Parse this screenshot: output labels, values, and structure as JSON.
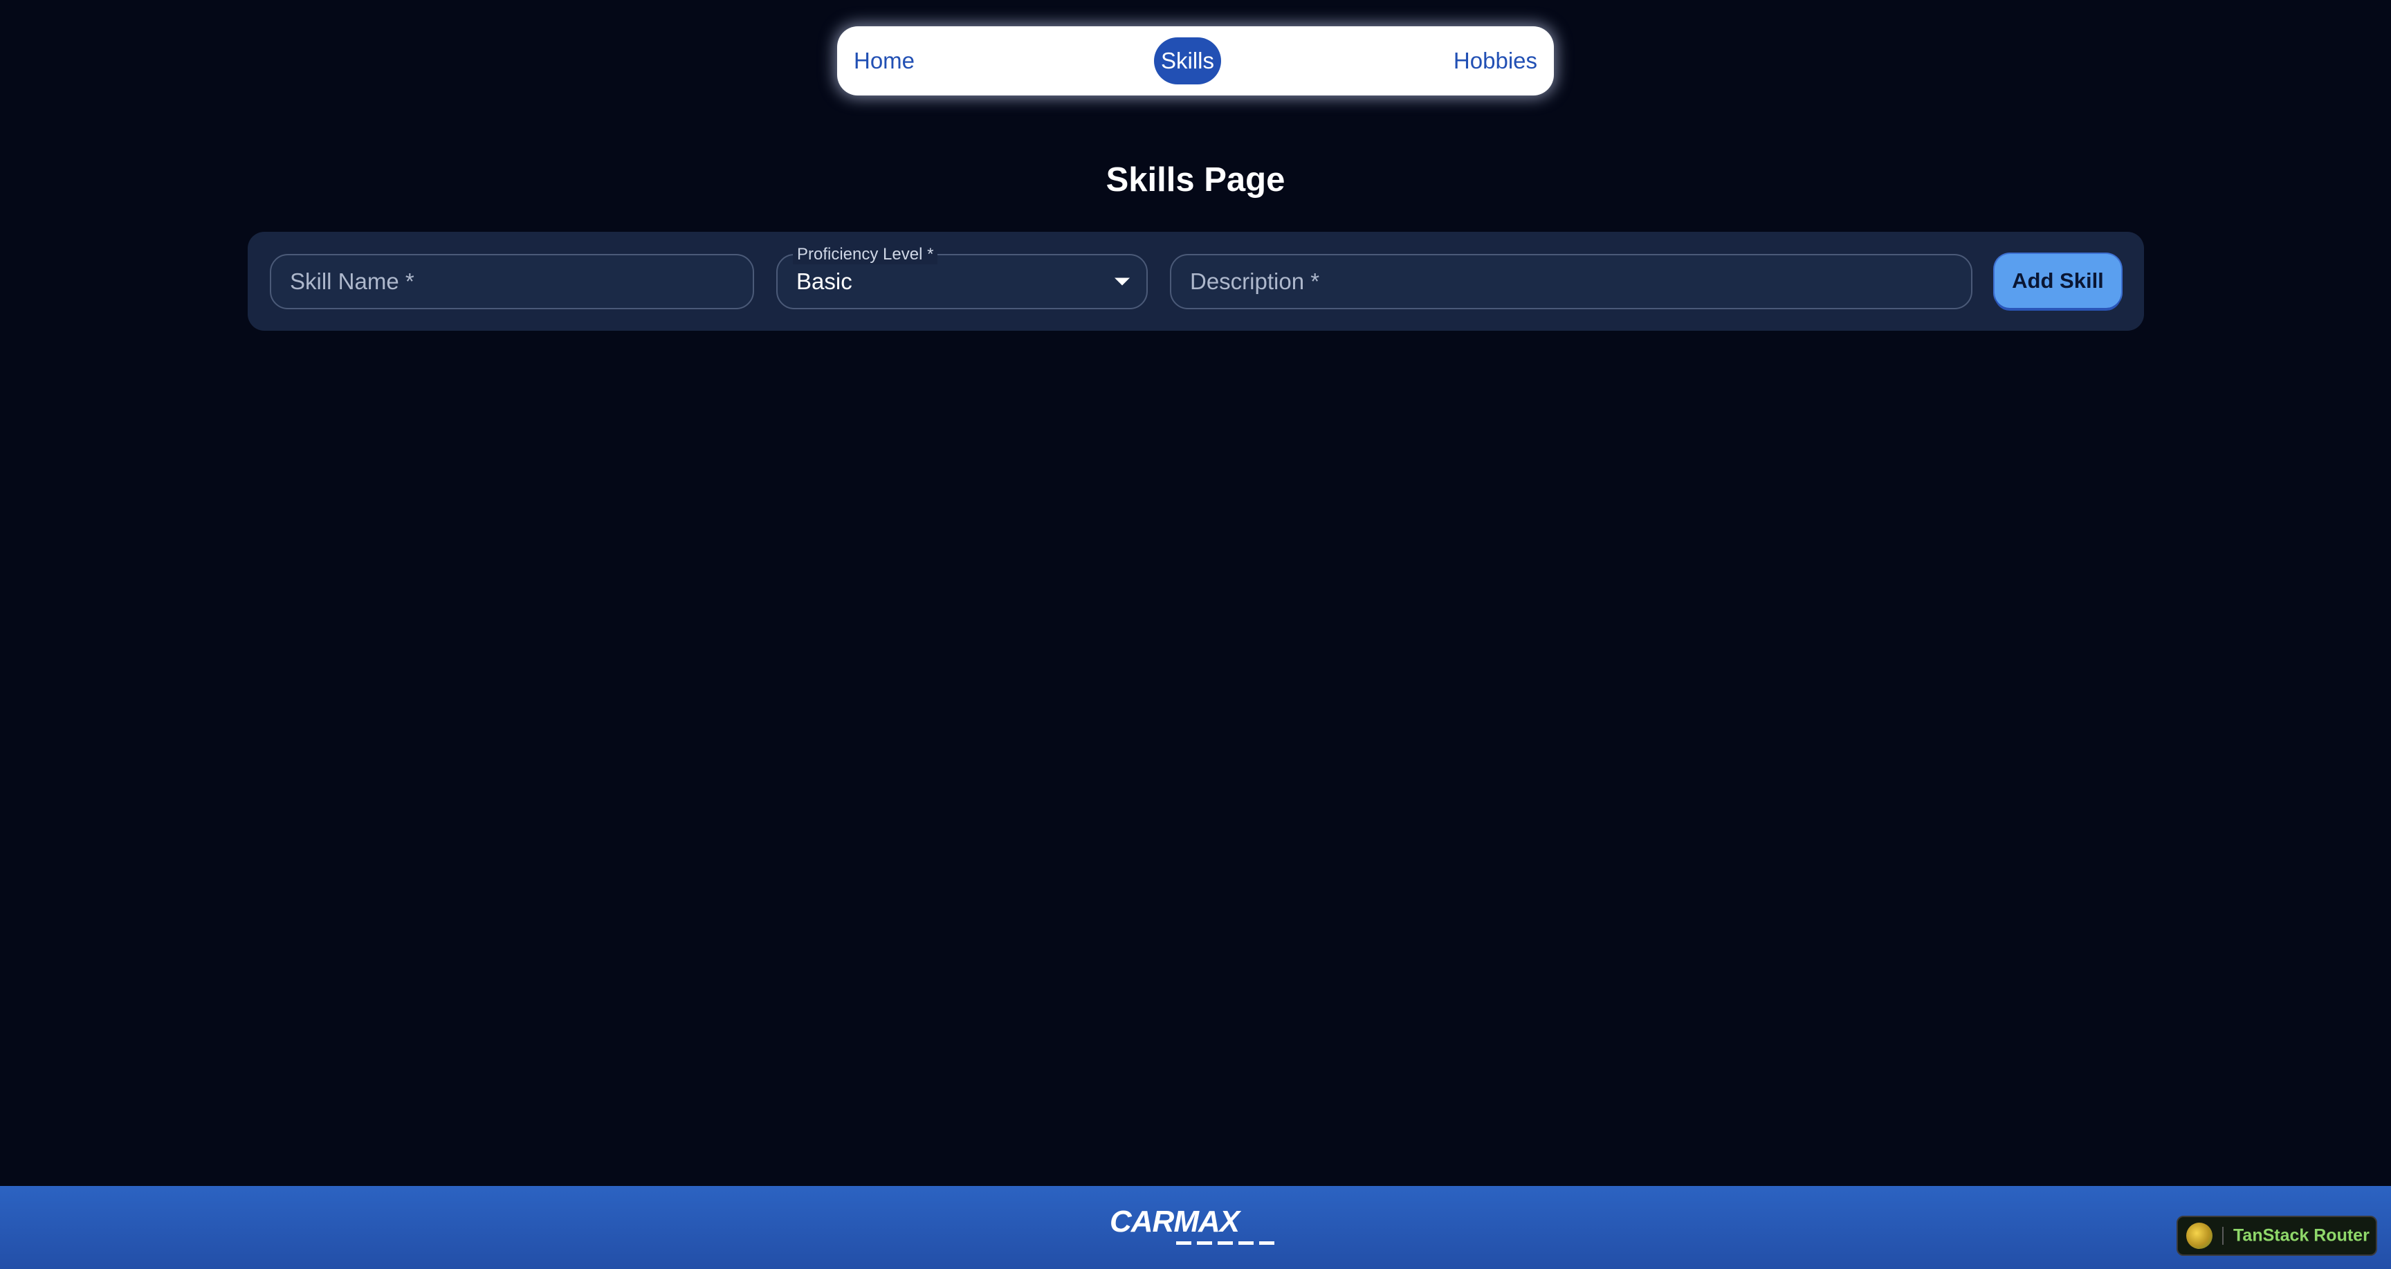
{
  "nav": {
    "home_label": "Home",
    "skills_label": "Skills",
    "hobbies_label": "Hobbies",
    "active": "Skills"
  },
  "page": {
    "title": "Skills Page"
  },
  "form": {
    "skill_name_placeholder": "Skill Name *",
    "skill_name_value": "",
    "proficiency_label": "Proficiency Level *",
    "proficiency_value": "Basic",
    "description_placeholder": "Description *",
    "description_value": "",
    "submit_label": "Add Skill"
  },
  "footer": {
    "logo_text": "CARMAX"
  },
  "devtools": {
    "badge_label": "TanStack Router"
  },
  "colors": {
    "background": "#040817",
    "nav_accent": "#2250b4",
    "card": "#182541",
    "button": "#5a9fef",
    "footer": "#2c63c2"
  },
  "icons": [
    "chevron-down-icon",
    "tanstack-router-icon",
    "carmax-logo"
  ]
}
